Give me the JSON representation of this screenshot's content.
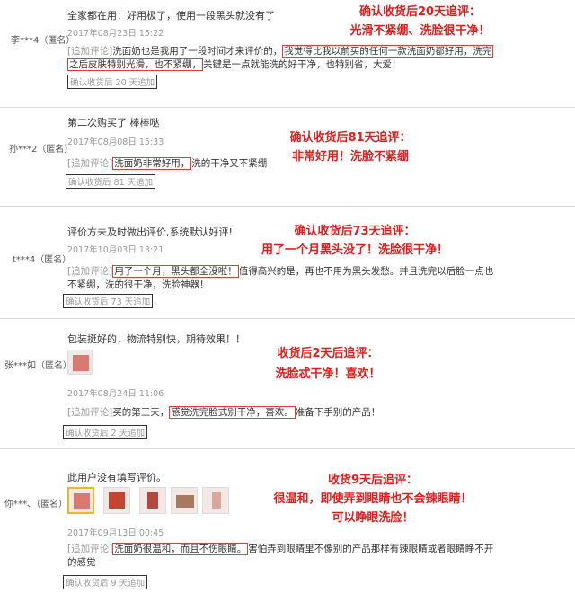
{
  "reviews": [
    {
      "user": "李***4（匿名）",
      "content": "全家都在用：好用极了，使用一段黑头就没有了",
      "date": "2017年08月23日 15:22",
      "followup_tag": "[追加评论]",
      "followup_line1_pre": "洗面奶也是我用了一段时间才来评价的，",
      "followup_line1_box": "我觉得比我以前买的任何一款洗面奶都好用，洗完",
      "followup_line2_box": "之后皮肤特别光滑，也不紧绷，",
      "followup_line2_post": "关键是一点就能洗的好干净，也特别省，大爱！",
      "days_label": "确认收货后 20 天追加",
      "annotation": [
        "确认收货后20天追评：",
        "光滑不紧绷、洗脸很干净！"
      ]
    },
    {
      "user": "孙***2（匿名）",
      "content": "第二次购买了 棒棒哒",
      "date": "2017年08月08日 15:33",
      "followup_tag": "[追加评论]",
      "followup_box": "洗面奶非常好用，",
      "followup_post": "洗的干净又不紧绷",
      "days_label": "确认收货后 81 天追加",
      "annotation": [
        "确认收货后81天追评：",
        "非常好用！洗脸不紧绷"
      ]
    },
    {
      "user": "t***4（匿名）",
      "content": "评价方未及时做出评价,系统默认好评!",
      "date": "2017年10月03日 13:21",
      "followup_tag": "[追加评论]",
      "followup_box": "用了一个月，黑头都全没啦！",
      "followup_post": "值得高兴的是，再也不用为黑头发愁。并且洗完以后脸一点也",
      "followup_line2": "不紧绷，洗的很干净，洗脸神器！",
      "days_label": "确认收货后 73 天追加",
      "annotation": [
        "确认收货后73天追评：",
        "用了一个月黑头没了！洗脸很干净！"
      ]
    },
    {
      "user": "张***如（匿名）",
      "content": "包装挺好的，物流特别快，期待效果！！",
      "date": "2017年08月24日 11:06",
      "followup_tag": "[追加评论]",
      "followup_pre": "买的第三天，",
      "followup_box": "感觉洗完脸式别干净，喜欢。",
      "followup_post": "准备下手别的产品！",
      "days_label": "确认收货后 2 天追加",
      "annotation": [
        "收货后2天后追评：",
        "洗脸忒干净！喜欢！"
      ]
    },
    {
      "user": "你***、（匿名）",
      "content": "此用户没有填写评价。",
      "date": "2017年09月13日 00:45",
      "followup_tag": "[追加评论]",
      "followup_box": "洗面奶很温和，而且不伤眼睛。",
      "followup_post": "害怕弄到眼睛里不像别的产品那样有辣眼睛或者眼睛睁不开",
      "followup_line2": "的感觉",
      "days_label": "确认收货后 9 天追加",
      "annotation": [
        "收货9天后追评：",
        "很温和，即使弄到眼睛也不会辣眼睛！",
        "可以睁眼洗脸！"
      ]
    }
  ]
}
